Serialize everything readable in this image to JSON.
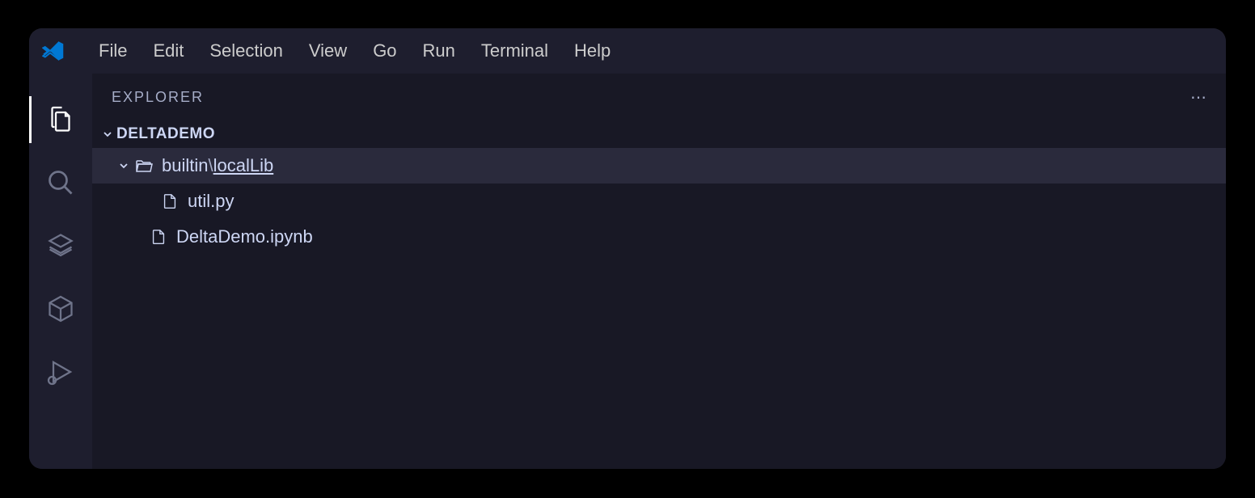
{
  "menu": {
    "items": [
      "File",
      "Edit",
      "Selection",
      "View",
      "Go",
      "Run",
      "Terminal",
      "Help"
    ]
  },
  "sidebar": {
    "title": "EXPLORER",
    "folder_name": "DELTADEMO",
    "more_actions": "⋯"
  },
  "tree": {
    "folder_prefix": "builtin",
    "folder_separator": "\\",
    "folder_suffix": "localLib",
    "files": [
      "util.py",
      "DeltaDemo.ipynb"
    ]
  }
}
